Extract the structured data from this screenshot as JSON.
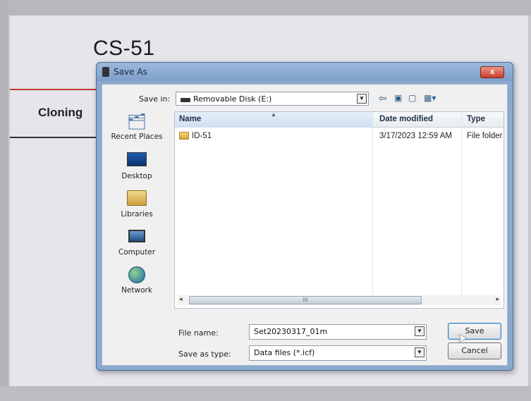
{
  "app": {
    "title": "CS-51",
    "section": "Cloning"
  },
  "dialog": {
    "title": "Save As",
    "close_label": "x",
    "save_in_label": "Save in:",
    "save_in_value": "Removable Disk (E:)",
    "toolbar_icons": [
      "back-arrow-icon",
      "up-folder-icon",
      "new-folder-icon",
      "view-menu-icon"
    ],
    "places": [
      {
        "label": "Recent Places",
        "icon": "recent-places-icon"
      },
      {
        "label": "Desktop",
        "icon": "desktop-icon"
      },
      {
        "label": "Libraries",
        "icon": "libraries-icon"
      },
      {
        "label": "Computer",
        "icon": "computer-icon"
      },
      {
        "label": "Network",
        "icon": "network-icon"
      }
    ],
    "columns": {
      "name": "Name",
      "date_modified": "Date modified",
      "type": "Type"
    },
    "rows": [
      {
        "name": "ID-51",
        "date_modified": "3/17/2023 12:59 AM",
        "type": "File folder"
      }
    ],
    "scrollbar_grip": "III",
    "file_name_label": "File name:",
    "file_name_value": "Set20230317_01m",
    "save_as_type_label": "Save as type:",
    "save_as_type_value": "Data files (*.icf)",
    "save_button": "Save",
    "cancel_button": "Cancel"
  },
  "colors": {
    "dialog_frame": "#8aa9cf",
    "close_button": "#c8402a",
    "accent_rule": "#c0392b"
  }
}
